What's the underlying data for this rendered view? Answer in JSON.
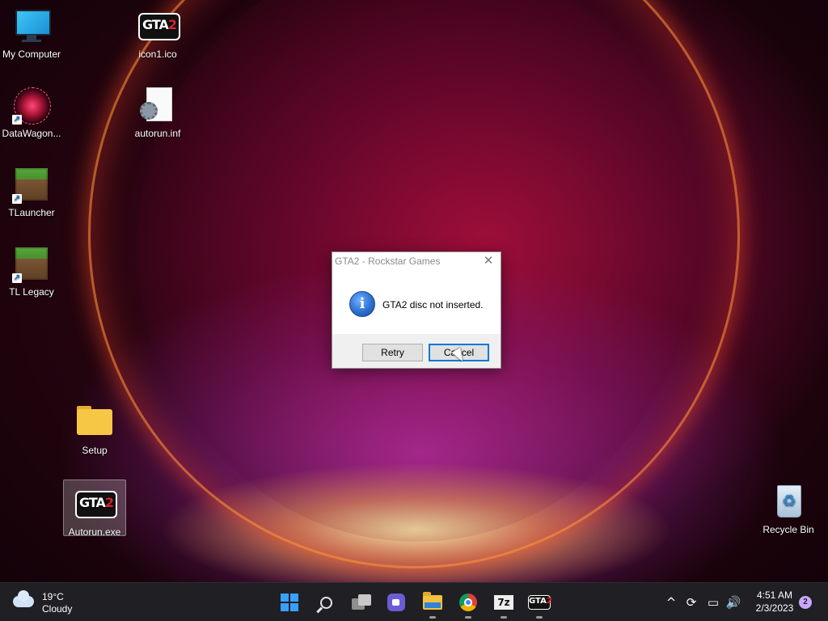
{
  "desktop": {
    "icons": [
      {
        "label": "My Computer"
      },
      {
        "label": "icon1.ico"
      },
      {
        "label": "DataWagon..."
      },
      {
        "label": "autorun.inf"
      },
      {
        "label": "TLauncher"
      },
      {
        "label": "TL Legacy"
      },
      {
        "label": "Setup"
      },
      {
        "label": "Autorun.exe"
      },
      {
        "label": "Recycle Bin"
      }
    ]
  },
  "dialog": {
    "title": "GTA2 - Rockstar Games",
    "close_glyph": "✕",
    "icon": "info-icon",
    "icon_glyph": "i",
    "message": "GTA2 disc not inserted.",
    "retry_label": "Retry",
    "cancel_label": "Cancel"
  },
  "logo": {
    "gta_prefix": "GTA",
    "gta_suffix": "2"
  },
  "taskbar": {
    "weather": {
      "temp": "19°C",
      "condition": "Cloudy"
    },
    "seven_zip_label": "7z",
    "tray": {
      "chevron": "^",
      "sync": "⟳",
      "network": "▭",
      "volume": "🔊"
    },
    "clock": {
      "time": "4:51 AM",
      "date": "2/3/2023"
    },
    "notifications": "2"
  },
  "colors": {
    "accent": "#0078d7",
    "taskbar_bg": "#1f1f24"
  }
}
